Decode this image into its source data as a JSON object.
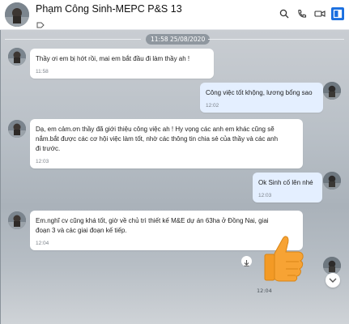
{
  "header": {
    "title": "Phạm Công Sinh-MEPC P&S 13",
    "icons": [
      "search-icon",
      "phone-icon",
      "video-icon",
      "sidebar-toggle-icon"
    ]
  },
  "chat": {
    "date_separator": "11:58 25/08/2020",
    "messages": [
      {
        "sender": "them",
        "text": "Thầy ơi em bị hớt rồi, mai em bắt đầu đi làm thầy ah !",
        "time": "11:58"
      },
      {
        "sender": "me",
        "text": "Công việc tốt khộng, lương bổng sao",
        "time": "12:02"
      },
      {
        "sender": "them",
        "text": "Dạ, em cảm.ơn thầy đã giới thiệu công việc ah ! Hy vọng các anh em khác cũng  sẽ\nnắm.bắt được các cơ hội việc làm tốt, nhờ các thông tin chia sẻ của thầy và các anh\nđi trước.",
        "time": "12:03"
      },
      {
        "sender": "me",
        "text": "Ok Sinh cố lên nhé",
        "time": "12:03"
      },
      {
        "sender": "them",
        "text": "Em.nghĩ cv cũng khá tốt, giờ về chủ trì thiết kế M&E dự án 63ha ở Đồng Nai, giai\nđoạn 3 và các giai đoạn kế tiếp.",
        "time": "12:04"
      }
    ],
    "sticker": {
      "name": "thumbs-up",
      "time": "12:04"
    }
  },
  "colors": {
    "accent": "#1a6fe0",
    "mine_bubble": "#e4efff",
    "thumb": "#f7a334"
  }
}
